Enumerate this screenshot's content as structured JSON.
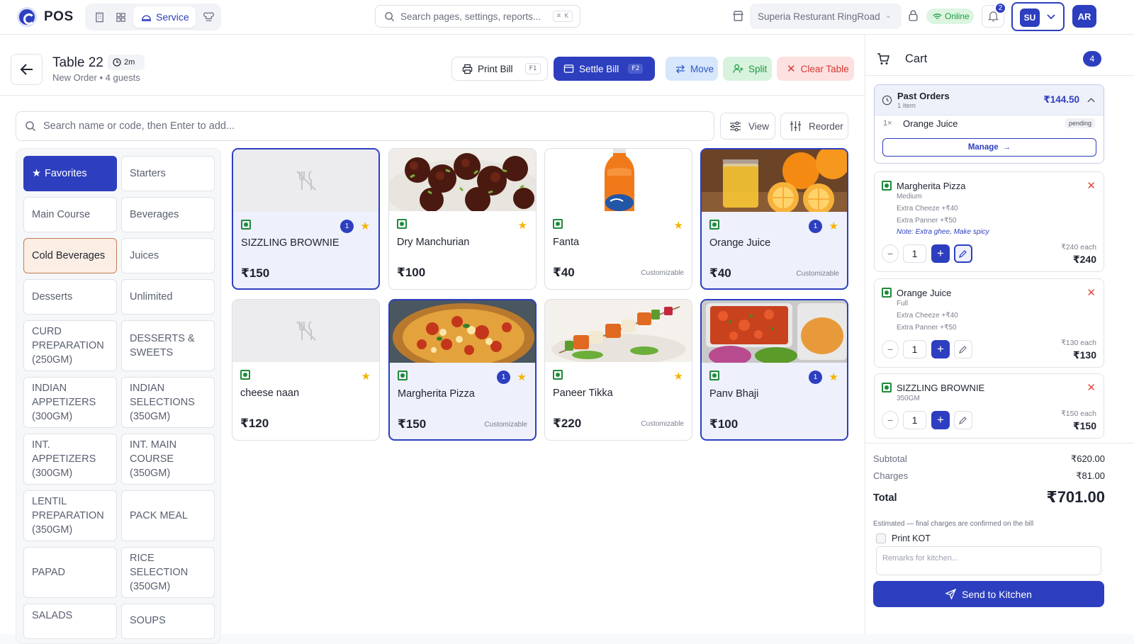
{
  "app": {
    "brand": "POS",
    "nav_service": "Service",
    "search_placeholder": "Search pages, settings, reports...",
    "search_shortcut": "⌘ K",
    "store": "Superia Resturant RingRoad",
    "status": "Online",
    "notifications": "2",
    "user_initials": "SU",
    "avatar_initials": "AR"
  },
  "table": {
    "title": "Table 22",
    "elapsed": "2m",
    "subtitle": "New Order • 4 guests"
  },
  "actions": {
    "print": "Print Bill",
    "print_key": "F1",
    "settle": "Settle Bill",
    "settle_key": "F2",
    "move": "Move",
    "split": "Split",
    "clear": "Clear Table"
  },
  "item_search": {
    "placeholder": "Search name or code, then Enter to add...",
    "view": "View",
    "reorder": "Reorder"
  },
  "categories": [
    "Favorites",
    "Starters",
    "Main Course",
    "Beverages",
    "Cold Beverages",
    "Juices",
    "Desserts",
    "Unlimited",
    "CURD PREPARATION (250GM)",
    "DESSERTS & SWEETS",
    "INDIAN APPETIZERS (300GM)",
    "INDIAN SELECTIONS (350GM)",
    "INT. APPETIZERS (300GM)",
    "INT. MAIN COURSE (350GM)",
    "LENTIL PREPARATION (350GM)",
    "PACK MEAL",
    "PAPAD",
    "RICE SELECTION (350GM)",
    "SALADS",
    "SOUPS"
  ],
  "items": [
    {
      "name": "SIZZLING BROWNIE",
      "price": "₹150",
      "qty": "1",
      "custom": ""
    },
    {
      "name": "Dry Manchurian",
      "price": "₹100",
      "qty": "",
      "custom": ""
    },
    {
      "name": "Fanta",
      "price": "₹40",
      "qty": "",
      "custom": "Customizable"
    },
    {
      "name": "Orange Juice",
      "price": "₹40",
      "qty": "1",
      "custom": "Customizable"
    },
    {
      "name": "cheese naan",
      "price": "₹120",
      "qty": "",
      "custom": ""
    },
    {
      "name": "Margherita Pizza",
      "price": "₹150",
      "qty": "1",
      "custom": "Customizable"
    },
    {
      "name": "Paneer Tikka",
      "price": "₹220",
      "qty": "",
      "custom": "Customizable"
    },
    {
      "name": "Panv Bhaji",
      "price": "₹100",
      "qty": "1",
      "custom": ""
    }
  ],
  "cart": {
    "title": "Cart",
    "count": "4",
    "past": {
      "title": "Past Orders",
      "sub": "1 item",
      "total": "₹144.50",
      "qty": "1×",
      "item": "Orange Juice",
      "status": "pending",
      "manage": "Manage"
    },
    "lines": [
      {
        "name": "Margherita Pizza",
        "variant": "Medium",
        "addon1": "Extra Cheeze +₹40",
        "addon2": "Extra Panner +₹50",
        "note": "Note: Extra ghee, Make spicy",
        "qty": "1",
        "each": "₹240 each",
        "total": "₹240"
      },
      {
        "name": "Orange Juice",
        "variant": "Full",
        "addon1": "Extra Cheeze +₹40",
        "addon2": "Extra Panner +₹50",
        "qty": "1",
        "each": "₹130 each",
        "total": "₹130"
      },
      {
        "name": "SIZZLING BROWNIE",
        "variant": "350GM",
        "qty": "1",
        "each": "₹150 each",
        "total": "₹150"
      }
    ],
    "subtotal_label": "Subtotal",
    "subtotal": "₹620.00",
    "charges_label": "Charges",
    "charges": "₹81.00",
    "total_label": "Total",
    "total": "₹701.00",
    "estimate": "Estimated — final charges are confirmed on the bill",
    "kot": "Print KOT",
    "remarks_placeholder": "Remarks for kitchen...",
    "send": "Send to Kitchen"
  }
}
